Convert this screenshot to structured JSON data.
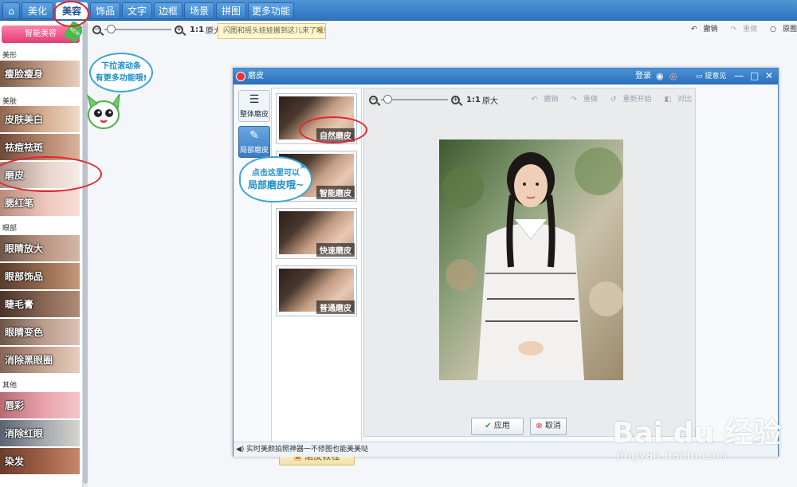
{
  "top_tabs": [
    {
      "label": "⌂"
    },
    {
      "label": "美化"
    },
    {
      "label": "美容"
    },
    {
      "label": "饰品"
    },
    {
      "label": "文字"
    },
    {
      "label": "边框"
    },
    {
      "label": "场景"
    },
    {
      "label": "拼图"
    },
    {
      "label": "更多功能"
    }
  ],
  "active_tab": "美容",
  "zoom": {
    "ratio": "1:1",
    "label": "原大",
    "level": 0.1
  },
  "notice": {
    "text": "闪图和摇头娃娃搬到这儿来了哦!",
    "close": "×"
  },
  "right_actions": {
    "undo": "撤销",
    "redo": "重做",
    "original": "原图"
  },
  "sidebar": {
    "smart_button": "智能美容",
    "new_badge": "NEW",
    "sections": {
      "shape": "美形",
      "skin": "美肤",
      "eyes": "眼部",
      "other": "其他"
    },
    "items": [
      {
        "label": "瘦脸瘦身"
      },
      {
        "label": "皮肤美白"
      },
      {
        "label": "祛痘祛斑"
      },
      {
        "label": "磨皮"
      },
      {
        "label": "腮红笔"
      },
      {
        "label": "眼睛放大"
      },
      {
        "label": "眼部饰品"
      },
      {
        "label": "睫毛膏"
      },
      {
        "label": "眼睛变色"
      },
      {
        "label": "消除黑眼圈"
      },
      {
        "label": "唇彩"
      },
      {
        "label": "消除红眼"
      },
      {
        "label": "染发"
      }
    ]
  },
  "hint_left": {
    "line1": "下拉滚动条",
    "line2": "有更多功能哦!"
  },
  "dialog": {
    "title": "磨皮",
    "login": "登录",
    "feedback": "提意见",
    "side_tabs": [
      {
        "label": "整体磨皮"
      },
      {
        "label": "局部磨皮"
      }
    ],
    "presets": [
      {
        "label": "自然磨皮"
      },
      {
        "label": "智能磨皮"
      },
      {
        "label": "快速磨皮"
      },
      {
        "label": "普通磨皮"
      }
    ],
    "hint": {
      "line1": "点击这里可以",
      "line2": "局部磨皮哦~",
      "close": "×"
    },
    "tutorial": "磨皮教程",
    "canvas_zoom": {
      "ratio": "1:1",
      "label": "原大",
      "level": 0.1
    },
    "canvas_actions": {
      "undo": "撤销",
      "redo": "重做",
      "reset": "重新开始",
      "compare": "对比"
    },
    "apply": "应用",
    "cancel": "取消",
    "status": "实时美颜拍照神器一不修图也能美美哒"
  },
  "watermark": {
    "main": "Bai du 经验",
    "sub": "jingyan.baidu.com"
  },
  "colors": {
    "accent": "#2e73bd",
    "highlight_ring": "#e0262d",
    "hint_blue": "#1c8ec9",
    "smart_pink": "#e23e74"
  }
}
